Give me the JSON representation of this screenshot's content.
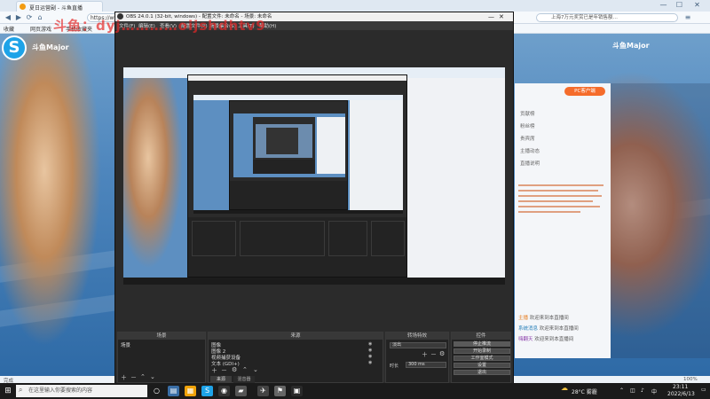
{
  "browser": {
    "tabs": [
      {
        "label": "夏日运营副 - 斗鱼直播",
        "color": "#f39c12"
      },
      {
        "label": "OBS",
        "color": "#444444"
      }
    ],
    "url": "https://www.",
    "search_placeholder": "上海7万元奖赏已是年销售额…",
    "bookmarks": [
      "收藏",
      "网页游戏",
      "手机收藏夹"
    ],
    "window_controls": {
      "min": "—",
      "max": "☐",
      "close": "✕"
    },
    "status_left": "完成",
    "status_right": "100%"
  },
  "site": {
    "logo_char": "S",
    "brand": "斗鱼Major",
    "right_panel": {
      "badge": "PC客户端",
      "rows": [
        "贡献榜",
        "粉丝榜",
        "贵宾席",
        "主播动态",
        "直播说明"
      ],
      "chat": [
        {
          "user": "主播",
          "text": "欢迎来到本直播间",
          "color": "#e67e22"
        },
        {
          "user": "系统消息",
          "text": "欢迎来到本直播间",
          "color": "#2980b9"
        },
        {
          "user": "嗨翻天",
          "text": "欢迎来到本直播间",
          "color": "#8e44ad"
        }
      ]
    }
  },
  "watermark": "斗鱼：dyj…………oijshdhtv9",
  "obs": {
    "title": "OBS 24.0.1 (32-bit, windows) - 配置文件: 未命名 - 场景: 未命名",
    "menu": [
      "文件(F)",
      "编辑(E)",
      "查看(V)",
      "配置文件(P)",
      "场景集合(S)",
      "工具(T)",
      "帮助(H)"
    ],
    "docks": {
      "scenes": {
        "title": "场景",
        "items": [
          "场景"
        ]
      },
      "sources": {
        "title": "来源",
        "items": [
          "图像",
          "图像 2",
          "视频捕获设备",
          "文本 (GDI+)"
        ]
      },
      "transitions": {
        "title": "转场特效",
        "selected": "淡出",
        "duration_label": "时长",
        "duration_value": "300 ms"
      },
      "controls": {
        "title": "控件",
        "buttons": [
          "停止推流",
          "开始录制",
          "工作室模式",
          "设置",
          "退出"
        ]
      },
      "mixer": {
        "tabs": [
          "来源",
          "混音器"
        ]
      }
    }
  },
  "taskbar": {
    "search_placeholder": "在这里输入你要搜索的内容",
    "weather": "28°C 雾霾",
    "time": "23:11",
    "date": "2022/6/13",
    "apps": [
      {
        "icon": "○",
        "color": "#1b1b1b"
      },
      {
        "icon": "▤",
        "color": "#3a6ea5"
      },
      {
        "icon": "▦",
        "color": "#f0a30a"
      },
      {
        "icon": "S",
        "color": "#1ea3e8"
      },
      {
        "icon": "◉",
        "color": "#333333"
      },
      {
        "icon": "▰",
        "color": "#555555"
      },
      {
        "icon": "✈",
        "color": "#444444"
      },
      {
        "icon": "⚑",
        "color": "#666666"
      },
      {
        "icon": "▣",
        "color": "#2a2a2a"
      }
    ]
  }
}
